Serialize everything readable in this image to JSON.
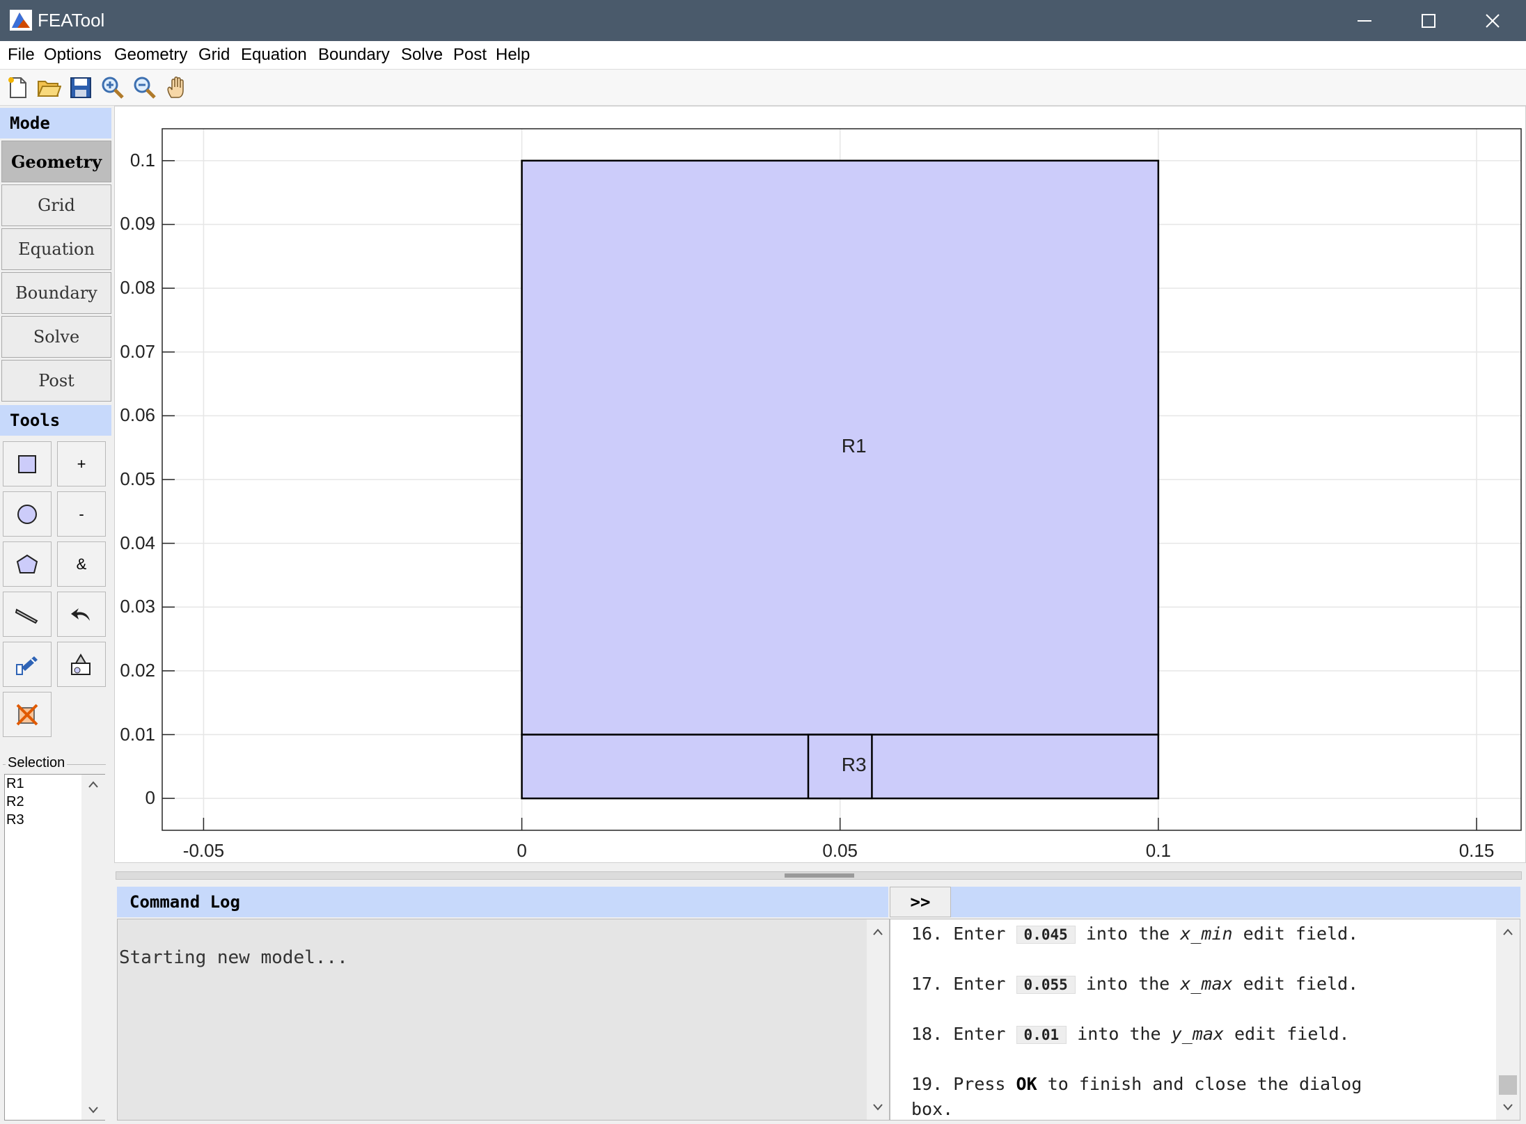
{
  "window": {
    "title": "FEATool"
  },
  "menu": [
    "File",
    "Options",
    "Geometry",
    "Grid",
    "Equation",
    "Boundary",
    "Solve",
    "Post",
    "Help"
  ],
  "toolbar": [
    "new-file-icon",
    "open-folder-icon",
    "save-icon",
    "zoom-in-icon",
    "zoom-out-icon",
    "pan-hand-icon"
  ],
  "mode": {
    "header": "Mode",
    "buttons": [
      "Geometry",
      "Grid",
      "Equation",
      "Boundary",
      "Solve",
      "Post"
    ],
    "active": "Geometry"
  },
  "tools": {
    "header": "Tools",
    "buttons": [
      "rectangle-icon",
      "+",
      "circle-icon",
      "-",
      "polygon-icon",
      "&",
      "line-icon",
      "undo-icon",
      "edit-icon",
      "transform-icon",
      "delete-icon"
    ]
  },
  "selection": {
    "label": "Selection",
    "items": [
      "R1",
      "R2",
      "R3"
    ]
  },
  "plot": {
    "x_ticks": [
      "-0.05",
      "0",
      "0.05",
      "0.1",
      "0.15"
    ],
    "y_ticks": [
      "0.1",
      "0.09",
      "0.08",
      "0.07",
      "0.06",
      "0.05",
      "0.04",
      "0.03",
      "0.02",
      "0.01",
      "0"
    ],
    "xlim": [
      -0.0565,
      0.157
    ],
    "ylim": [
      -0.005,
      0.105
    ],
    "fill_color": "#ccccfa",
    "shapes": [
      {
        "label": "R1",
        "x": [
          0,
          0.1
        ],
        "y": [
          0.01,
          0.1
        ]
      },
      {
        "label": "R2",
        "x": [
          0,
          0.1
        ],
        "y": [
          0,
          0.01
        ]
      },
      {
        "label": "R3",
        "x": [
          0.045,
          0.055
        ],
        "y": [
          0,
          0.01
        ]
      }
    ],
    "labels": [
      "R1",
      "R3"
    ]
  },
  "command_log": {
    "header": "Command Log",
    "expand": ">>",
    "lines": [
      "Starting new model..."
    ]
  },
  "help": {
    "steps": [
      {
        "num": "16.",
        "pre": "Enter",
        "value": "0.045",
        "mid": "into the",
        "var": "x_min",
        "post": "edit field."
      },
      {
        "num": "17.",
        "pre": "Enter",
        "value": "0.055",
        "mid": "into the",
        "var": "x_max",
        "post": "edit field."
      },
      {
        "num": "18.",
        "pre": "Enter",
        "value": "0.01",
        "mid": "into the",
        "var": "y_max",
        "post": "edit field."
      }
    ],
    "step19": {
      "num": "19.",
      "pre": "Press",
      "key": "OK",
      "post": "to finish and close the dialog",
      "post2": "box."
    }
  }
}
